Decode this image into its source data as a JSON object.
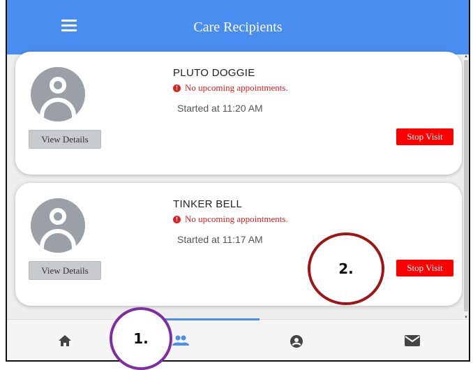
{
  "header": {
    "title": "Care Recipients",
    "menu_icon": "hamburger-menu-icon",
    "bg_color": "#4a8df0"
  },
  "recipients": [
    {
      "name": "PLUTO DOGGIE",
      "alert": "No upcoming appointments.",
      "started": "Started at 11:20 AM",
      "view_label": "View Details",
      "stop_label": "Stop Visit"
    },
    {
      "name": "TINKER BELL",
      "alert": "No upcoming appointments.",
      "started": "Started at 11:17 AM",
      "view_label": "View Details",
      "stop_label": "Stop Visit"
    }
  ],
  "nav": {
    "tabs": [
      "home-icon",
      "people-icon",
      "account-circle-icon",
      "mail-icon"
    ],
    "active": 1
  },
  "annotations": {
    "one": "1.",
    "two": "2."
  },
  "colors": {
    "alert": "#e02020",
    "stop": "#ff0000",
    "annot_one": "#7b2fa0",
    "annot_two": "#a01414"
  }
}
